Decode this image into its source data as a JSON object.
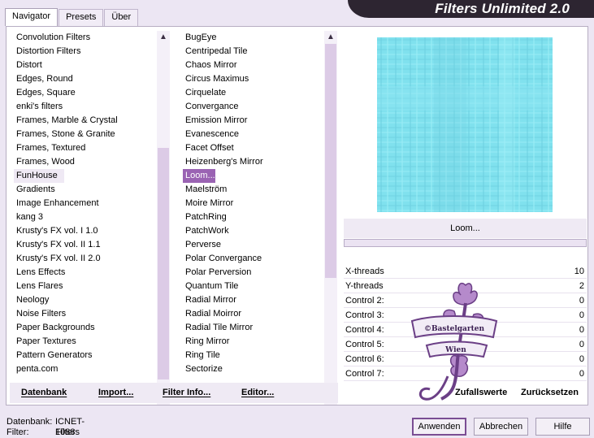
{
  "tabs": [
    "Navigator",
    "Presets",
    "Über"
  ],
  "title": "Filters Unlimited 2.0",
  "categories": [
    "Convolution Filters",
    "Distortion Filters",
    "Distort",
    "Edges, Round",
    "Edges, Square",
    "enki's filters",
    "Frames, Marble & Crystal",
    "Frames, Stone & Granite",
    "Frames, Textured",
    "Frames, Wood",
    "FunHouse",
    "Gradients",
    "Image Enhancement",
    "kang 3",
    "Krusty's FX vol. I 1.0",
    "Krusty's FX vol. II 1.1",
    "Krusty's FX vol. II 2.0",
    "Lens Effects",
    "Lens Flares",
    "Neology",
    "Noise Filters",
    "Paper Backgrounds",
    "Paper Textures",
    "Pattern Generators",
    "penta.com"
  ],
  "selected_category": "FunHouse",
  "filters": [
    "BugEye",
    "Centripedal Tile",
    "Chaos Mirror",
    "Circus Maximus",
    "Cirquelate",
    "Convergance",
    "Emission Mirror",
    "Evanescence",
    "Facet Offset",
    "Heizenberg's Mirror",
    "Loom...",
    "Maelström",
    "Moire Mirror",
    "PatchRing",
    "PatchWork",
    "Perverse",
    "Polar Convergance",
    "Polar Perversion",
    "Quantum Tile",
    "Radial Mirror",
    "Radial Moirror",
    "Radial Tile Mirror",
    "Ring Mirror",
    "Ring Tile",
    "Sectorize"
  ],
  "selected_filter": "Loom...",
  "preview_color": "#7fe0ed",
  "current_filter_name": "Loom...",
  "controls": [
    {
      "label": "X-threads",
      "value": "10"
    },
    {
      "label": "Y-threads",
      "value": "2"
    },
    {
      "label": "Control 2:",
      "value": "0"
    },
    {
      "label": "Control 3:",
      "value": "0"
    },
    {
      "label": "Control 4:",
      "value": "0"
    },
    {
      "label": "Control 5:",
      "value": "0"
    },
    {
      "label": "Control 6:",
      "value": "0"
    },
    {
      "label": "Control 7:",
      "value": "0"
    }
  ],
  "watermark": {
    "line1": "©Bastelgarten",
    "line2": "Wien"
  },
  "toolbar": {
    "datenbank": "Datenbank",
    "import": "Import...",
    "filter_info": "Filter Info...",
    "editor": "Editor..."
  },
  "random_values": "Zufallswerte",
  "reset": "Zurücksetzen",
  "status": {
    "db_label": "Datenbank:",
    "db_value": "ICNET-Filters",
    "filter_label": "Filter:",
    "filter_value": "1088"
  },
  "buttons": {
    "apply": "Anwenden",
    "cancel": "Abbrechen",
    "help": "Hilfe"
  },
  "accent_color": "#9a63b3"
}
